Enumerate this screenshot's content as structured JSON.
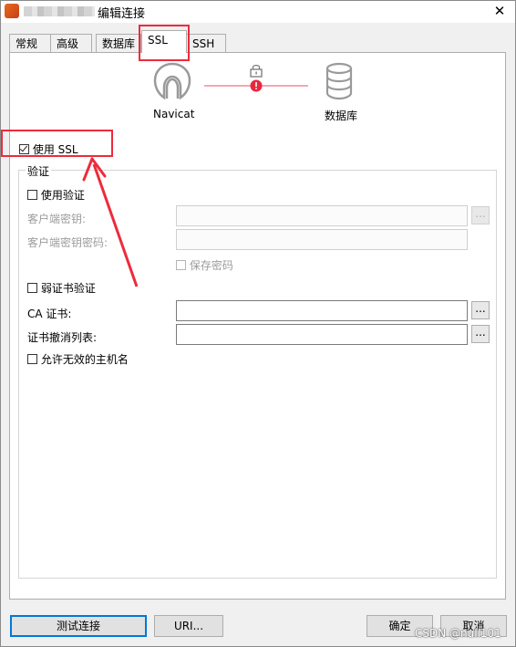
{
  "window": {
    "title": "编辑连接",
    "close_glyph": "✕"
  },
  "tabs": [
    {
      "label": "常规"
    },
    {
      "label": "高级"
    },
    {
      "label": "数据库"
    },
    {
      "label": "SSL",
      "selected": true
    },
    {
      "label": "SSH"
    }
  ],
  "diagram": {
    "left_label": "Navicat",
    "right_label": "数据库",
    "status_color": "#e8283c",
    "lock_icon": "lock-icon"
  },
  "use_ssl": {
    "label": "使用 SSL",
    "checked": true
  },
  "auth": {
    "legend": "验证",
    "use_auth": {
      "label": "使用验证",
      "checked": false
    },
    "client_key_label": "客户端密钥:",
    "client_key_value": "",
    "client_key_password_label": "客户端密钥密码:",
    "client_key_password_value": "",
    "save_password_label": "保存密码",
    "weak_cert": {
      "label": "弱证书验证",
      "checked": false
    },
    "ca_cert_label": "CA 证书:",
    "ca_cert_value": "",
    "crl_label": "证书撤消列表:",
    "crl_value": "",
    "allow_invalid_host": {
      "label": "允许无效的主机名",
      "checked": false
    },
    "browse_glyph": "..."
  },
  "buttons": {
    "test": "测试连接",
    "uri": "URI...",
    "ok": "确定",
    "cancel": "取消"
  },
  "watermark": "CSDN @null101",
  "colors": {
    "annotation": "#ee2b3c",
    "primary_border": "#0078d7"
  }
}
